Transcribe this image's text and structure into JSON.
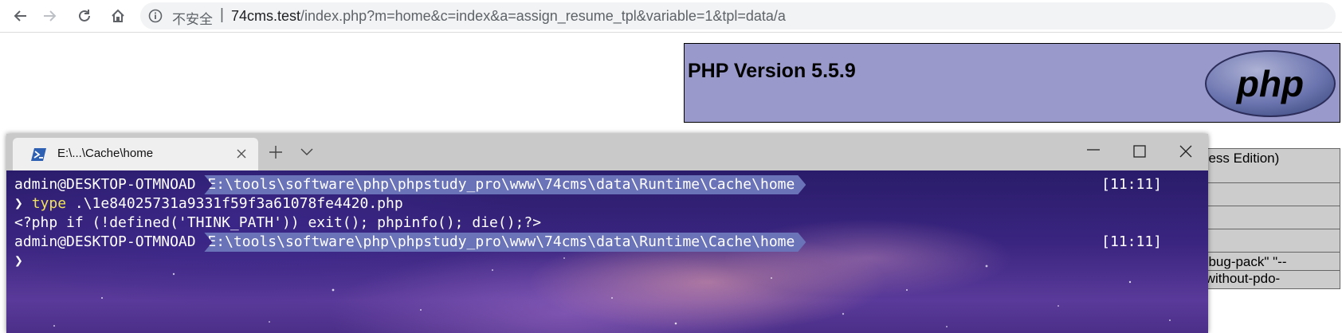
{
  "browser": {
    "security_label": "不安全",
    "separator": "|",
    "url_host": "74cms.test",
    "url_path": "/index.php?m=home&c=index&a=assign_resume_tpl&variable=1&tpl=data/a"
  },
  "phpinfo": {
    "version_heading": "PHP Version 5.5.9",
    "logo_text": "php",
    "table_rows": [
      "ness Edition)",
      "",
      "",
      "",
      "ebug-pack\" \"--",
      "-without-pdo-"
    ],
    "colors": {
      "header_bg": "#9999cc",
      "cell_bg": "#cccccc"
    }
  },
  "terminal": {
    "tab_title": "E:\\...\\Cache\\home",
    "lines": [
      {
        "user": "admin@DESKTOP-OTMNOAD",
        "path": "E:\\tools\\software\\php\\phpstudy_pro\\www\\74cms\\data\\Runtime\\Cache\\home",
        "time": "[11:11]"
      },
      {
        "prompt": "❯",
        "command": "type",
        "args": " .\\1e84025731a9331f59f3a61078fe4420.php"
      },
      {
        "output": "<?php if (!defined('THINK_PATH')) exit(); phpinfo(); die();?>"
      },
      {
        "user": "admin@DESKTOP-OTMNOAD",
        "path": "E:\\tools\\software\\php\\phpstudy_pro\\www\\74cms\\data\\Runtime\\Cache\\home",
        "time": "[11:11]"
      },
      {
        "prompt": "❯"
      }
    ],
    "colors": {
      "path_segment": "#6a73b8",
      "command_keyword": "#f1e35b"
    }
  }
}
